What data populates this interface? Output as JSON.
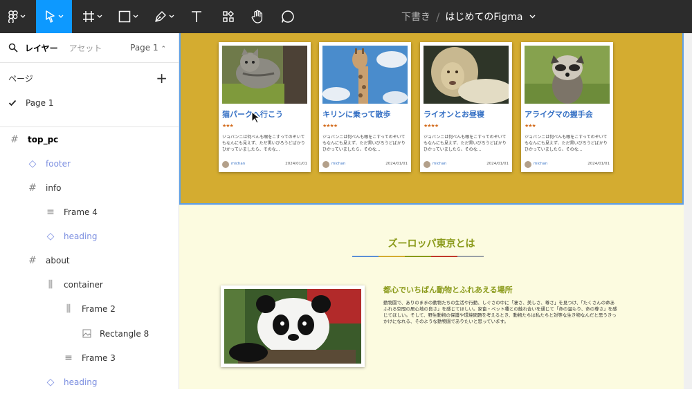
{
  "toolbar": {
    "draft_label": "下書き",
    "separator": "/",
    "file_name": "はじめてのFigma",
    "icons": [
      "figma-menu-icon",
      "move-tool-icon",
      "frame-tool-icon",
      "shape-tool-icon",
      "pen-tool-icon",
      "text-tool-icon",
      "resources-icon",
      "hand-tool-icon",
      "comment-icon"
    ]
  },
  "panel": {
    "tab_layers": "レイヤー",
    "tab_assets": "アセット",
    "page_selector": "Page 1",
    "pages_header": "ページ",
    "add_page": "+",
    "pages": [
      {
        "label": "Page 1",
        "active": true
      }
    ],
    "layers": [
      {
        "label": "top_pc",
        "icon": "frame-icon"
      },
      {
        "label": "footer",
        "icon": "component-icon"
      },
      {
        "label": "info",
        "icon": "frame-icon"
      },
      {
        "label": "Frame 4",
        "icon": "auto-layout-vertical-icon"
      },
      {
        "label": "heading",
        "icon": "component-icon"
      },
      {
        "label": "about",
        "icon": "frame-icon"
      },
      {
        "label": "container",
        "icon": "auto-layout-horizontal-icon"
      },
      {
        "label": "Frame 2",
        "icon": "auto-layout-horizontal-icon"
      },
      {
        "label": "Rectangle 8",
        "icon": "image-icon"
      },
      {
        "label": "Frame 3",
        "icon": "auto-layout-vertical-icon"
      },
      {
        "label": "heading",
        "icon": "component-icon"
      }
    ]
  },
  "canvas": {
    "cards": [
      {
        "title": "猫パークへ行こう",
        "stars": "★★★",
        "text": "ジョバンニは何べんも眼をこすってのぞいてもなんにも見えず、ただ黒いびろうどばかりひかっていましたら、そのな...",
        "author": "michan",
        "date": "2024/01/01",
        "image": "cat"
      },
      {
        "title": "キリンに乗って散歩",
        "stars": "★★★★",
        "text": "ジョバンニは何べんも眼をこすってのぞいてもなんにも見えず、ただ黒いびろうどばかりひかっていましたら、そのな...",
        "author": "michan",
        "date": "2024/01/01",
        "image": "giraffe"
      },
      {
        "title": "ライオンとお昼寝",
        "stars": "★★★★",
        "text": "ジョバンニは何べんも眼をこすってのぞいてもなんにも見えず、ただ黒いびろうどばかりひかっていましたら、そのな...",
        "author": "michan",
        "date": "2024/01/01",
        "image": "lion"
      },
      {
        "title": "アライグマの握手会",
        "stars": "★★★",
        "text": "ジョバンニは何べんも眼をこすってのぞいてもなんにも見えず、ただ黒いびろうどばかりひかっていましたら、そのな...",
        "author": "michan",
        "date": "2024/01/01",
        "image": "raccoon"
      }
    ],
    "about": {
      "heading": "ズーロッパ東京とは",
      "subheading": "都心でいちばん動物とふれあえる場所",
      "body": "動物園で、ありのままの動物たちの生活や行動、しぐさの中に「凄さ、美しさ、尊さ」を見つけ、「たくさんの命あふれる空間の居心地の良さ」を感じてほしい。家畜・ペット種との触れ合いを通じて「命の温もり、命の尊さ」を感じてほしい。そして、野生動物の保護や環境問題を考えるとき、動物たちは私たちと対等な生き物なんだと思うきっかけになれる、そのような動物園でありたいと思っています。",
      "underline_colors": [
        "#5b8fd6",
        "#d4ac30",
        "#8a9a1a",
        "#c0392b",
        "#9aa0a6"
      ]
    }
  },
  "colors": {
    "toolbar_bg": "#2c2c2c",
    "accent": "#0d99ff",
    "hero_bg": "#d4ac30",
    "about_bg": "#fcfbe0",
    "card_title": "#3570c4"
  }
}
